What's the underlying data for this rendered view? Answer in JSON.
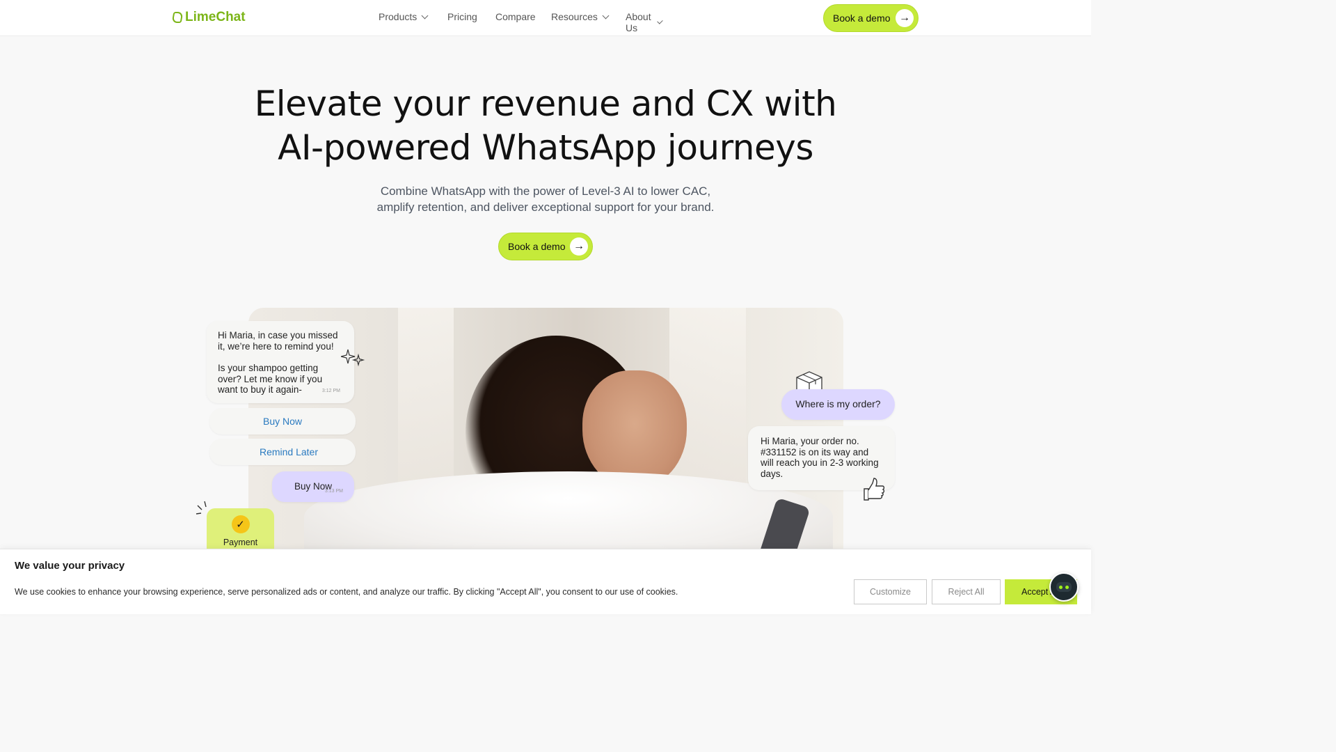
{
  "header": {
    "logo_text": "LimeChat",
    "nav": [
      {
        "label": "Products",
        "has_dropdown": true
      },
      {
        "label": "Pricing",
        "has_dropdown": false
      },
      {
        "label": "Compare",
        "has_dropdown": false
      },
      {
        "label": "Resources",
        "has_dropdown": true
      },
      {
        "label": "About Us",
        "has_dropdown": true
      }
    ],
    "cta_label": "Book a demo"
  },
  "hero": {
    "title_line1": "Elevate your revenue and CX with",
    "title_line2": "AI-powered WhatsApp journeys",
    "subtitle_line1": "Combine WhatsApp with the power of Level-3 AI to lower CAC,",
    "subtitle_line2": "amplify retention, and deliver exceptional support for your brand.",
    "cta_label": "Book a demo"
  },
  "chat": {
    "reminder_p1": "Hi Maria, in case you missed it, we’re here to remind you!",
    "reminder_p2": "Is your shampoo getting over? Let me know if you want to buy it again-",
    "reminder_time": "3:12 PM",
    "quick_reply_1": "Buy Now",
    "quick_reply_2": "Remind Later",
    "user_reply": "Buy Now",
    "user_reply_time": "3:13 PM",
    "payment_label": "Payment",
    "order_question": "Where is my order?",
    "order_answer": "Hi Maria, your order no. #331152 is on its way and will reach you in 2-3 working days."
  },
  "cookie": {
    "title": "We value your privacy",
    "text": "We use cookies to enhance your browsing experience, serve personalized ads or content, and analyze our traffic. By clicking \"Accept All\", you consent to our use of cookies.",
    "customize_label": "Customize",
    "reject_label": "Reject All",
    "accept_label": "Accept All"
  },
  "colors": {
    "brand_green": "#7cb518",
    "cta_lime": "#c5ea3a",
    "bubble_purple": "#ddd7ff",
    "payment_yellow": "#dff07a",
    "link_blue": "#2a7ac0"
  },
  "icons": [
    "chevron-down-icon",
    "arrow-right-icon",
    "sparkle-icon",
    "package-icon",
    "thumbs-up-icon",
    "check-icon",
    "chatbot-icon"
  ]
}
